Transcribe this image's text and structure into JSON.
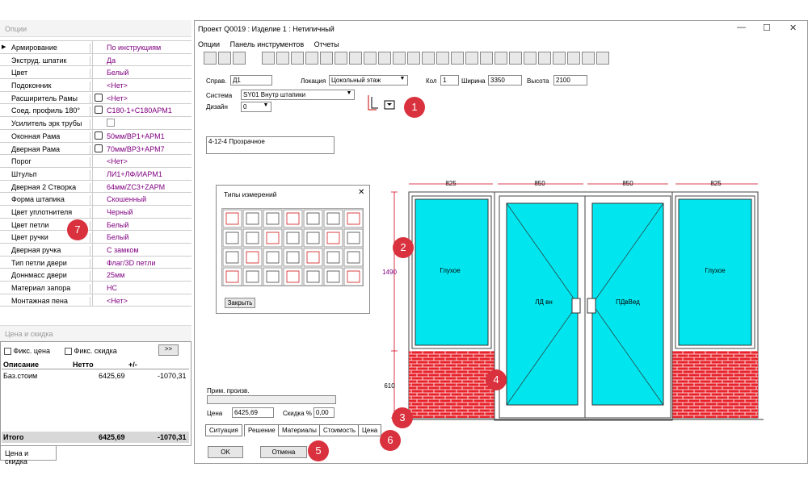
{
  "options_panel": {
    "title": "Опции",
    "rows": [
      {
        "label": "Армирование",
        "value": "По инструкциям",
        "selected": true
      },
      {
        "label": "Экструд. шпатик",
        "value": "Да"
      },
      {
        "label": "Цвет",
        "value": "Белый"
      },
      {
        "label": "Подоконник",
        "value": "<Нет>"
      },
      {
        "label": "Расширитель Рамы",
        "value": "<Нет>",
        "icon": true
      },
      {
        "label": "Соед. профиль 180°",
        "value": "C180-1+C180APM1",
        "icon": true
      },
      {
        "label": "Усилитель эрк трубы",
        "value": "",
        "checkbox": true
      },
      {
        "label": "Оконная Рама",
        "value": "50мм/BP1+APM1",
        "icon": true
      },
      {
        "label": "Дверная Рама",
        "value": "70мм/BP3+APM7",
        "icon": true
      },
      {
        "label": "Порог",
        "value": "<Нет>"
      },
      {
        "label": "Штульп",
        "value": "ЛИ1+ЛФ/ИAPM1"
      },
      {
        "label": "Дверная 2 Створка",
        "value": "64мм/ZC3+ZAPM"
      },
      {
        "label": "Форма штапика",
        "value": "Скошенный"
      },
      {
        "label": "Цвет уплотнителя",
        "value": "Черный"
      },
      {
        "label": "Цвет петли",
        "value": "Белый"
      },
      {
        "label": "Цвет ручки",
        "value": "Белый"
      },
      {
        "label": "Дверная ручка",
        "value": "С замком"
      },
      {
        "label": "Тип петли двери",
        "value": "Флаг/3D петли"
      },
      {
        "label": "Доннмасс двери",
        "value": "25мм"
      },
      {
        "label": "Материал запора",
        "value": "НС"
      },
      {
        "label": "Монтажная пена",
        "value": "<Нет>"
      }
    ]
  },
  "price_panel": {
    "title": "Цена и скидка",
    "fix_price": "Фикс. цена",
    "fix_discount": "Фикс. скидка",
    "more_button": ">>",
    "columns": [
      "Описание",
      "Нетто",
      "+/-"
    ],
    "rows": [
      {
        "desc": "Баз.стоим",
        "netto": "6425,69",
        "diff": "-1070,31"
      }
    ],
    "total": {
      "label": "Итого",
      "netto": "6425,69",
      "diff": "-1070,31"
    },
    "tab": "Цена и скидка"
  },
  "window": {
    "title": "Проект Q0019   : Изделие  1 : Нетипичный",
    "menu": [
      "Опции",
      "Панель инструментов",
      "Отчеты"
    ],
    "controls": {
      "min": "—",
      "max": "☐",
      "close": "✕"
    }
  },
  "form": {
    "sprav_label": "Справ.",
    "sprav_value": "Д1",
    "location_label": "Локация",
    "location_value": "Цокольный этаж",
    "qty_label": "Кол",
    "qty_value": "1",
    "width_label": "Ширина",
    "width_value": "3350",
    "height_label": "Высота",
    "height_value": "2100",
    "system_label": "Система",
    "system_value": "SY01  Внутр штапики",
    "design_label": "Дизайн",
    "design_value": "0",
    "glass_value": "4-12-4 Прозрачное",
    "note_label": "Прим. произв.",
    "price_label": "Цена",
    "price_value": "6425,69",
    "discount_label": "Скидка %",
    "discount_value": "0,00"
  },
  "dialog": {
    "title": "Типы измерений",
    "close_button": "Закрыть",
    "close_icon": "✕"
  },
  "tabs": [
    "Ситуация",
    "Решение",
    "Материалы",
    "Стоимость",
    "Цена"
  ],
  "buttons": {
    "ok": "OK",
    "cancel": "Отмена"
  },
  "drawing": {
    "widths": [
      "825",
      "850",
      "850",
      "825"
    ],
    "heights": [
      "1490",
      "610"
    ],
    "panel_labels": [
      "Глухое",
      "ЛД вн",
      "ПДвВед",
      "Глухое"
    ]
  },
  "badges": [
    "1",
    "2",
    "3",
    "4",
    "5",
    "6",
    "7"
  ],
  "colors": {
    "glass": "#00e5ee",
    "brick": "#e8222a",
    "badge": "#d9313d",
    "dim_line": "#d0021b",
    "value_text": "#800080"
  }
}
